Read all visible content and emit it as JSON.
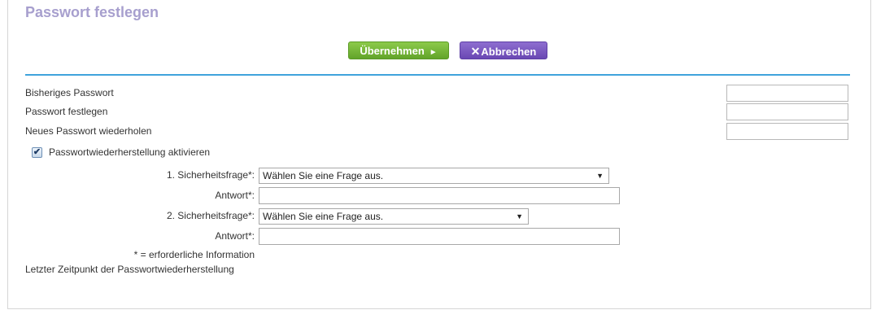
{
  "page": {
    "title": "Passwort festlegen"
  },
  "actions": {
    "apply_label": "Übernehmen",
    "apply_icon": "►",
    "cancel_icon": "✕",
    "cancel_label": "Abbrechen"
  },
  "password": {
    "old_label": "Bisheriges Passwort",
    "old_value": "",
    "new_label": "Passwort festlegen",
    "new_value": "",
    "repeat_label": "Neues Passwort wiederholen",
    "repeat_value": ""
  },
  "recovery": {
    "enable_label": "Passwortwiederherstellung aktivieren",
    "enabled": true,
    "q1_label": "1. Sicherheitsfrage*:",
    "q1_selected": "Wählen Sie eine Frage aus.",
    "a1_label": "Antwort*:",
    "a1_value": "",
    "q2_label": "2. Sicherheitsfrage*:",
    "q2_selected": "Wählen Sie eine Frage aus.",
    "a2_label": "Antwort*:",
    "a2_value": "",
    "required_note": "* = erforderliche Information",
    "last_recovery_label": "Letzter Zeitpunkt der Passwortwiederherstellung"
  },
  "colors": {
    "title": "#a79fce",
    "apply_button": "#6fb235",
    "cancel_button": "#7a58c2",
    "divider": "#3fa3dc"
  }
}
